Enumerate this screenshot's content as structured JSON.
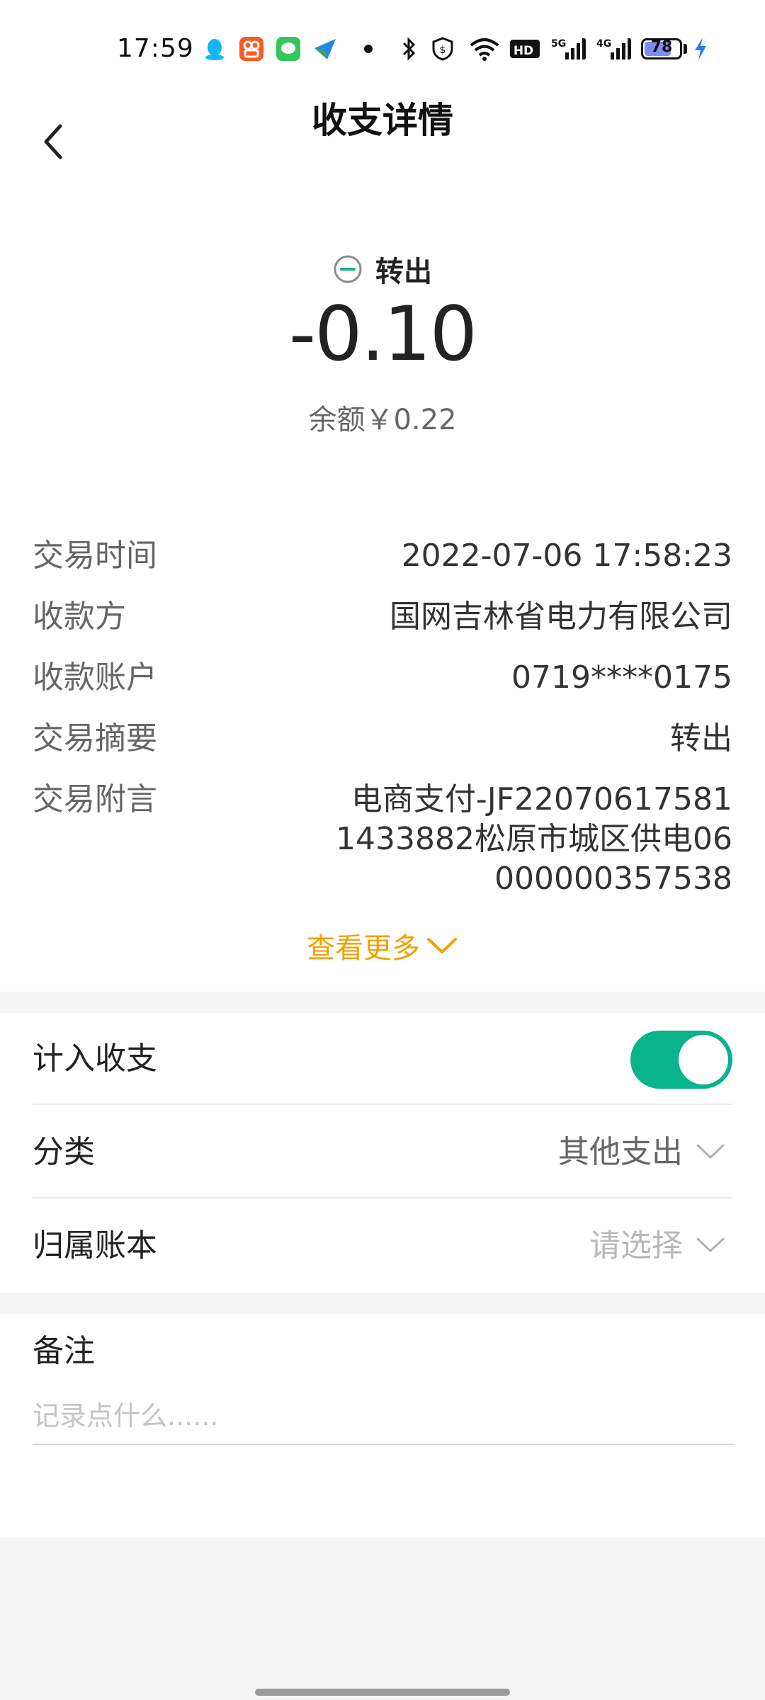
{
  "status_bar": {
    "time": "17:59",
    "hd_label": "HD",
    "network_5g": "5G",
    "network_4g": "4G",
    "battery_percent": "78",
    "icons": [
      "qq-icon",
      "kuaishou-icon",
      "message-icon",
      "navigation-icon",
      "dot-icon",
      "bluetooth-icon",
      "vpn-shield-icon",
      "wifi-icon",
      "hd-icon",
      "signal-5g-icon",
      "signal-4g-icon",
      "battery-icon",
      "charging-icon"
    ]
  },
  "header": {
    "title": "收支详情"
  },
  "summary": {
    "type_label": "转出",
    "amount": "-0.10",
    "balance": "余额￥0.22",
    "accent_color": "#09b38b"
  },
  "details": {
    "rows": [
      {
        "label": "交易时间",
        "value": "2022-07-06 17:58:23"
      },
      {
        "label": "收款方",
        "value": "国网吉林省电力有限公司"
      },
      {
        "label": "收款账户",
        "value": "0719****0175"
      },
      {
        "label": "交易摘要",
        "value": "转出"
      },
      {
        "label": "交易附言",
        "value": "电商支付-JF220706175811433882松原市城区供电06000000357538"
      }
    ],
    "more_label": "查看更多",
    "more_color": "#f2a100"
  },
  "settings": {
    "include_label": "计入收支",
    "include_on": true,
    "category_label": "分类",
    "category_value": "其他支出",
    "book_label": "归属账本",
    "book_placeholder": "请选择"
  },
  "note": {
    "title": "备注",
    "placeholder": "记录点什么......",
    "value": ""
  }
}
